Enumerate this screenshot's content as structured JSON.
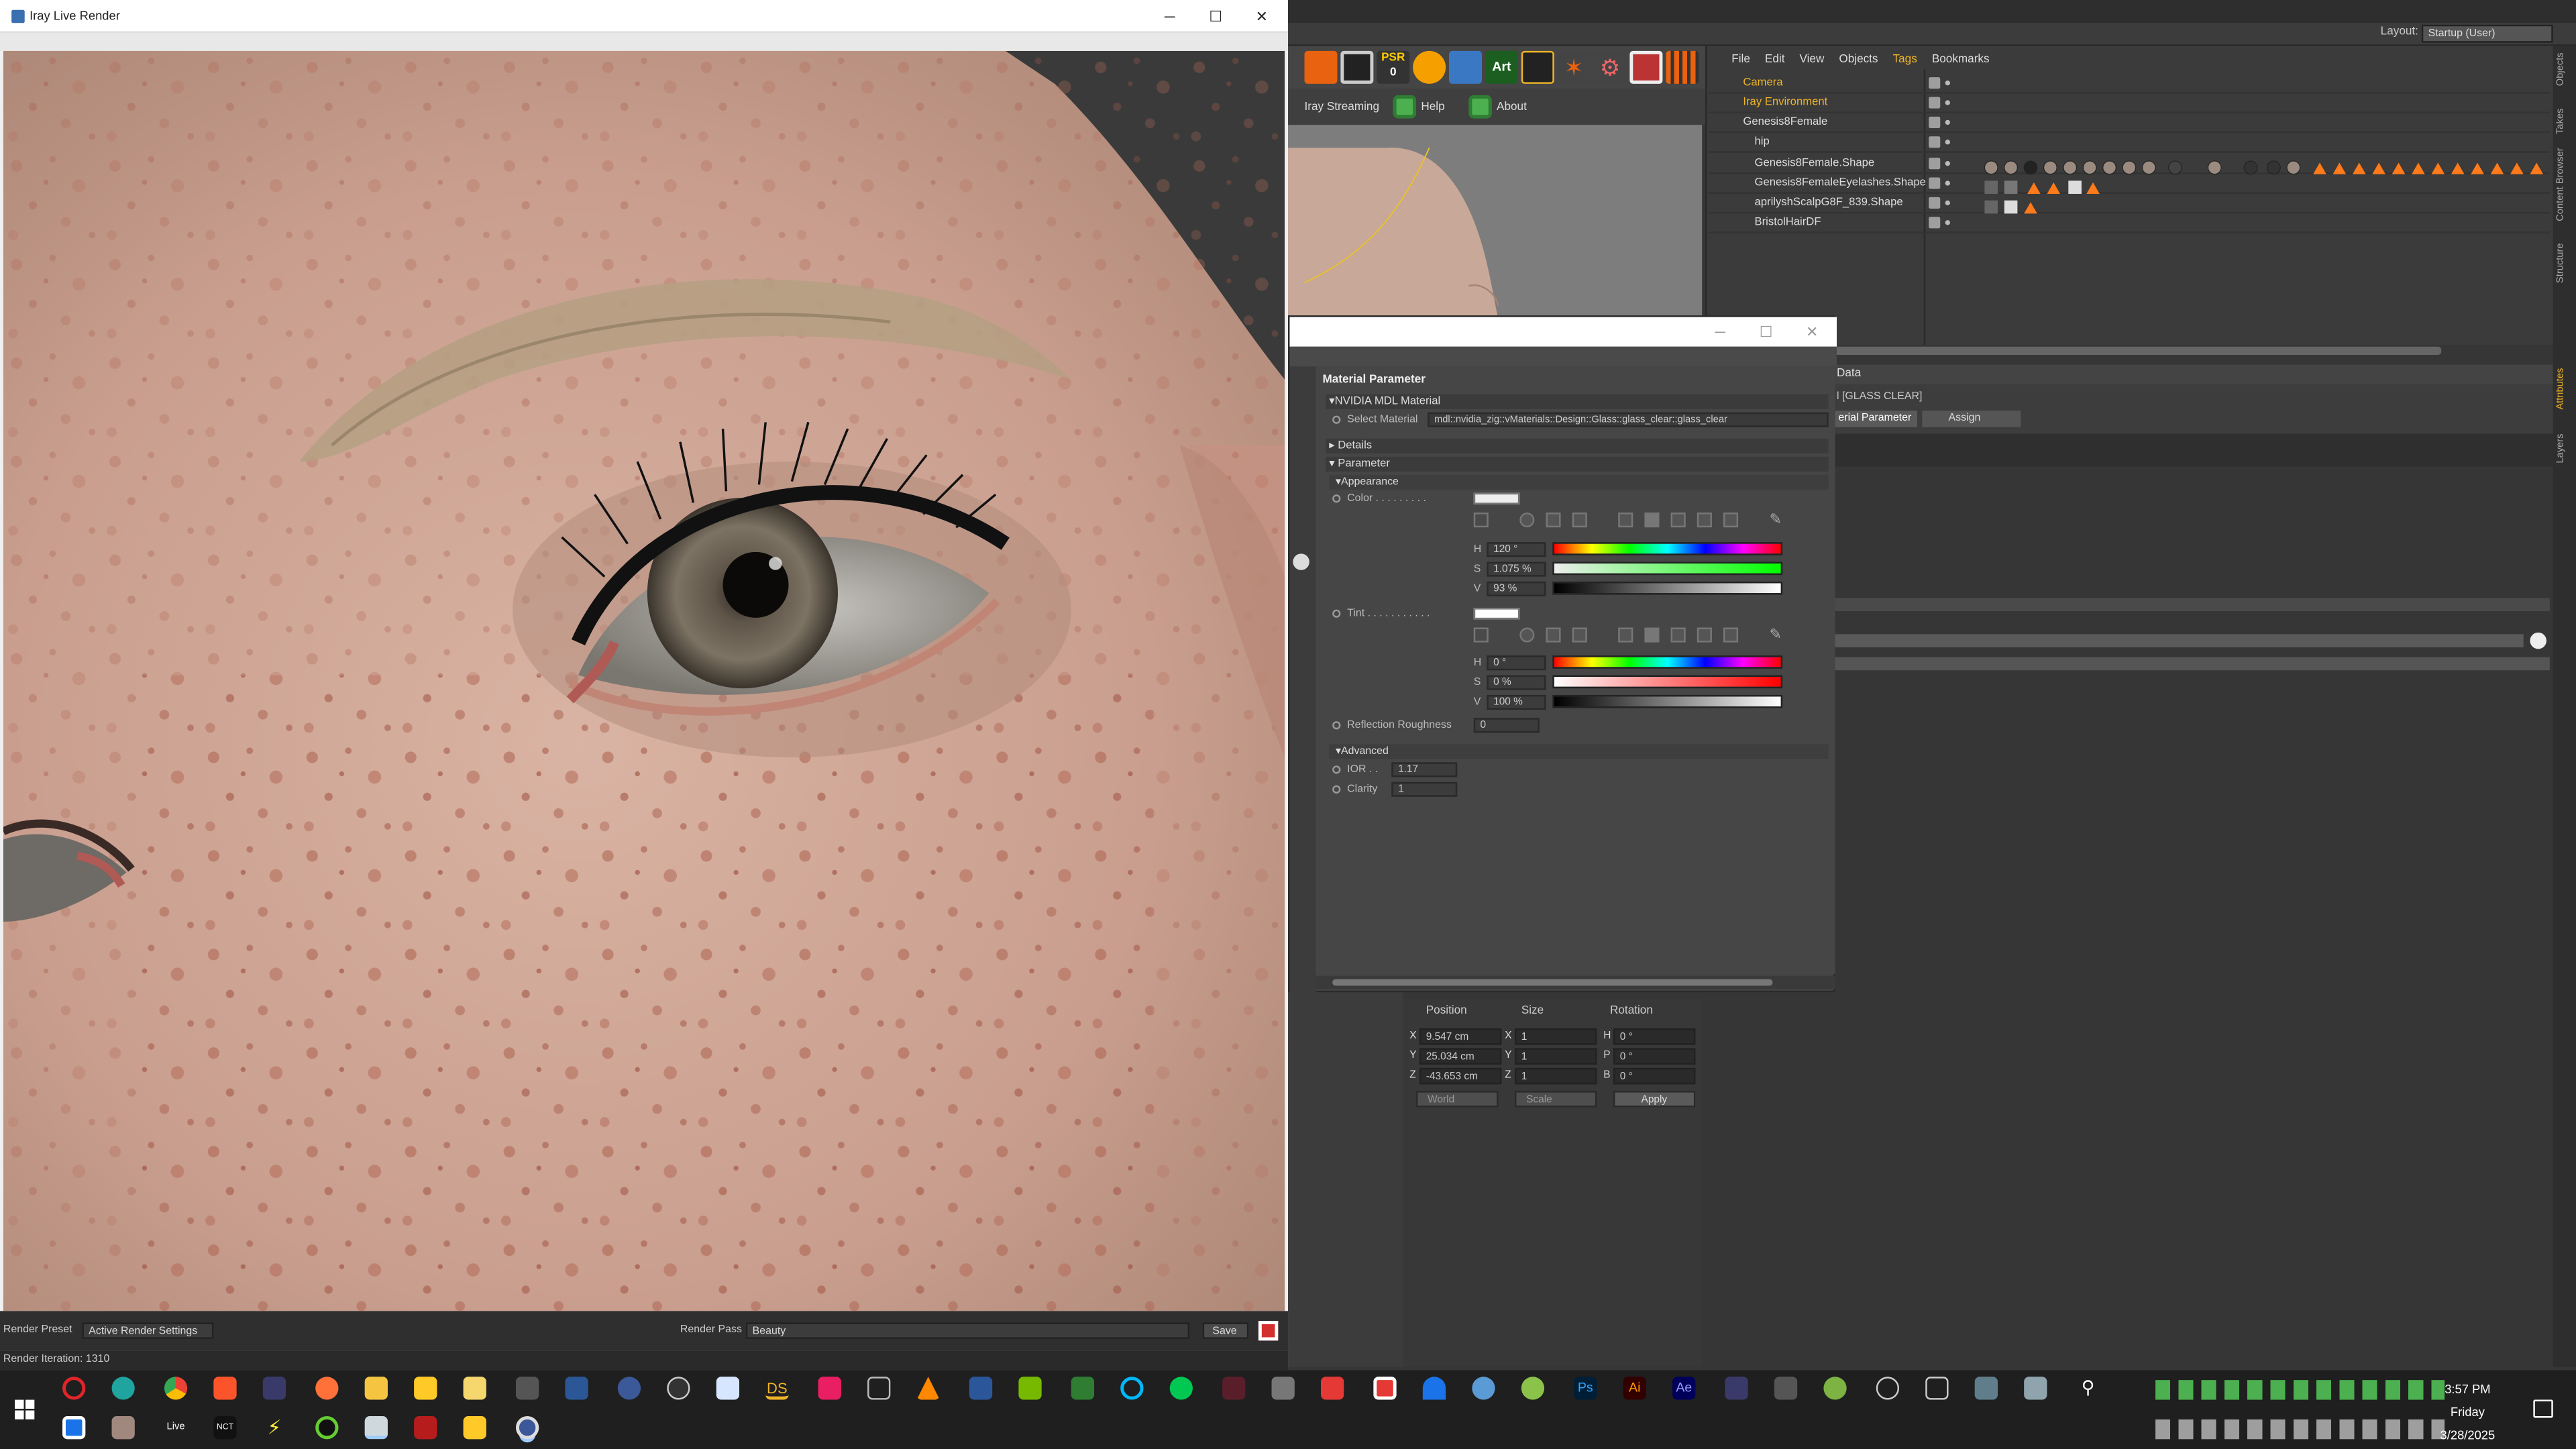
{
  "iray": {
    "title": "Iray Live Render",
    "render_preset_label": "Render Preset",
    "render_preset_value": "Active Render Settings",
    "render_pass_label": "Render Pass",
    "render_pass_value": "Beauty",
    "save_label": "Save",
    "status": "Render Iteration: 1310"
  },
  "c4d": {
    "layout_label": "Layout:",
    "layout_value": "Startup (User)",
    "toolbar_psr": "PSR",
    "toolbar_psr_num": "0",
    "toolbar_art": "Art",
    "streaming_label": "Iray Streaming",
    "help_label": "Help",
    "about_label": "About",
    "om_menu": [
      "File",
      "Edit",
      "View",
      "Objects",
      "Tags",
      "Bookmarks"
    ],
    "objects": [
      {
        "name": "Camera",
        "color": "#f0b429",
        "indent": 0
      },
      {
        "name": "Iray Environment",
        "color": "#f0b429",
        "indent": 0
      },
      {
        "name": "Genesis8Female",
        "color": "#d0d0d0",
        "indent": 0
      },
      {
        "name": "hip",
        "color": "#d0d0d0",
        "indent": 1
      },
      {
        "name": "Genesis8Female.Shape",
        "color": "#d0d0d0",
        "indent": 1
      },
      {
        "name": "Genesis8FemaleEyelashes.Shape",
        "color": "#d0d0d0",
        "indent": 1
      },
      {
        "name": "aprilyshScalpG8F_839.Shape",
        "color": "#d0d0d0",
        "indent": 1
      },
      {
        "name": "BristolHairDF",
        "color": "#d0d0d0",
        "indent": 1
      }
    ],
    "attr_data_label": "Data",
    "attr_glass": "l [GLASS CLEAR]",
    "attr_tab_param": "erial Parameter",
    "attr_tab_assign": "Assign",
    "side_tabs": [
      "Objects",
      "Takes",
      "Content Browser",
      "Structure",
      "Attributes",
      "Layers"
    ]
  },
  "coords": {
    "position_label": "Position",
    "size_label": "Size",
    "rotation_label": "Rotation",
    "rows": [
      {
        "axis": "X",
        "pos": "9.547 cm",
        "size_axis": "X",
        "size": "1",
        "rot_axis": "H",
        "rot": "0 °"
      },
      {
        "axis": "Y",
        "pos": "25.034 cm",
        "size_axis": "Y",
        "size": "1",
        "rot_axis": "P",
        "rot": "0 °"
      },
      {
        "axis": "Z",
        "pos": "-43.653 cm",
        "size_axis": "Z",
        "size": "1",
        "rot_axis": "B",
        "rot": "0 °"
      }
    ],
    "world_label": "World",
    "scale_label": "Scale",
    "apply_label": "Apply"
  },
  "material": {
    "header": "Material Parameter",
    "section_mdl": "NVIDIA MDL Material",
    "select_label": "Select Material",
    "select_value": "mdl::nvidia_zig::vMaterials::Design::Glass::glass_clear::glass_clear",
    "details": "Details",
    "parameter": "Parameter",
    "appearance": "Appearance",
    "color_label": "Color",
    "color_h": "120 °",
    "color_s": "1.075 %",
    "color_v": "93 %",
    "tint_label": "Tint",
    "tint_h": "0 °",
    "tint_s": "0 %",
    "tint_v": "100 %",
    "h": "H",
    "s": "S",
    "v": "V",
    "roughness_label": "Reflection Roughness",
    "roughness_value": "0",
    "advanced": "Advanced",
    "ior_label": "IOR",
    "ior_value": "1.17",
    "clarity_label": "Clarity",
    "clarity_value": "1"
  },
  "taskbar": {
    "time": "3:57 PM",
    "day": "Friday",
    "date": "3/28/2025",
    "ds_label": "DS",
    "ps_label": "Ps",
    "ai_label": "Ai",
    "ae_label": "Ae",
    "live_label": "Live",
    "nct_label": "NCT"
  }
}
